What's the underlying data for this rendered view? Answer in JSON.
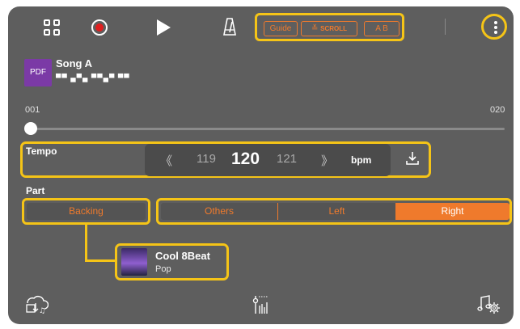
{
  "toolbar": {
    "guide_label": "Guide",
    "scroll_label": "SCROLL",
    "ab_label": "A B",
    "colors": {
      "accent": "#ef7a2c",
      "highlight": "#f5c417",
      "record": "#e01e1e"
    }
  },
  "song": {
    "file_type": "PDF",
    "title": "Song A",
    "subtitle": "▀▀ ▄▀▄ ▀▀▄▀ ▀▀"
  },
  "position": {
    "start": "001",
    "end": "020",
    "current_fraction": 0.0
  },
  "tempo": {
    "label": "Tempo",
    "prev": "119",
    "current": "120",
    "next": "121",
    "unit": "bpm"
  },
  "part": {
    "label": "Part",
    "backing": "Backing",
    "options": [
      "Others",
      "Left",
      "Right"
    ],
    "selected": "Right"
  },
  "style": {
    "name": "Cool 8Beat",
    "genre": "Pop"
  },
  "bottom_icons": [
    "download-style-icon",
    "mixer-icon",
    "music-settings-icon"
  ]
}
